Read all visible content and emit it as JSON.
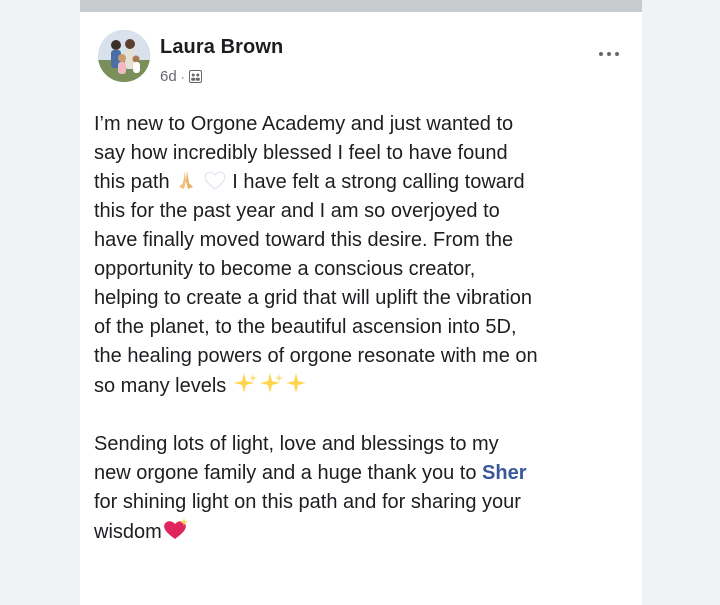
{
  "post": {
    "author": "Laura Brown",
    "time": "6d",
    "separator": "·",
    "paragraph1": {
      "line1": "I’m new to Orgone Academy and just wanted to",
      "line2": "say how incredibly blessed I feel to have found",
      "line3_a": "this path",
      "line3_b": "I have felt a strong calling toward",
      "line4": "this for the past year and I am so overjoyed to",
      "line5": "have finally moved toward this desire. From the",
      "line6": "opportunity to become a conscious creator,",
      "line7": "helping to create a grid that will uplift the vibration",
      "line8": "of the planet, to the beautiful ascension into 5D,",
      "line9": "the healing powers of orgone resonate with me on",
      "line10": "so many levels"
    },
    "paragraph2": {
      "line1": "Sending lots of light, love and blessings to my",
      "line2_a": "new orgone family and a huge thank you to",
      "mention": "Sher",
      "line3": "for shining light on this path and for sharing your",
      "line4": "wisdom"
    }
  },
  "colors": {
    "background": "#f1f2f4",
    "card": "#ffffff",
    "text": "#1c1e21",
    "meta": "#65676b",
    "mention": "#385898"
  },
  "icons": [
    "avatar-photo",
    "privacy-icon",
    "more-icon",
    "praying-hands-emoji",
    "white-heart-emoji",
    "sparkles-emoji",
    "sparkling-heart-emoji"
  ]
}
